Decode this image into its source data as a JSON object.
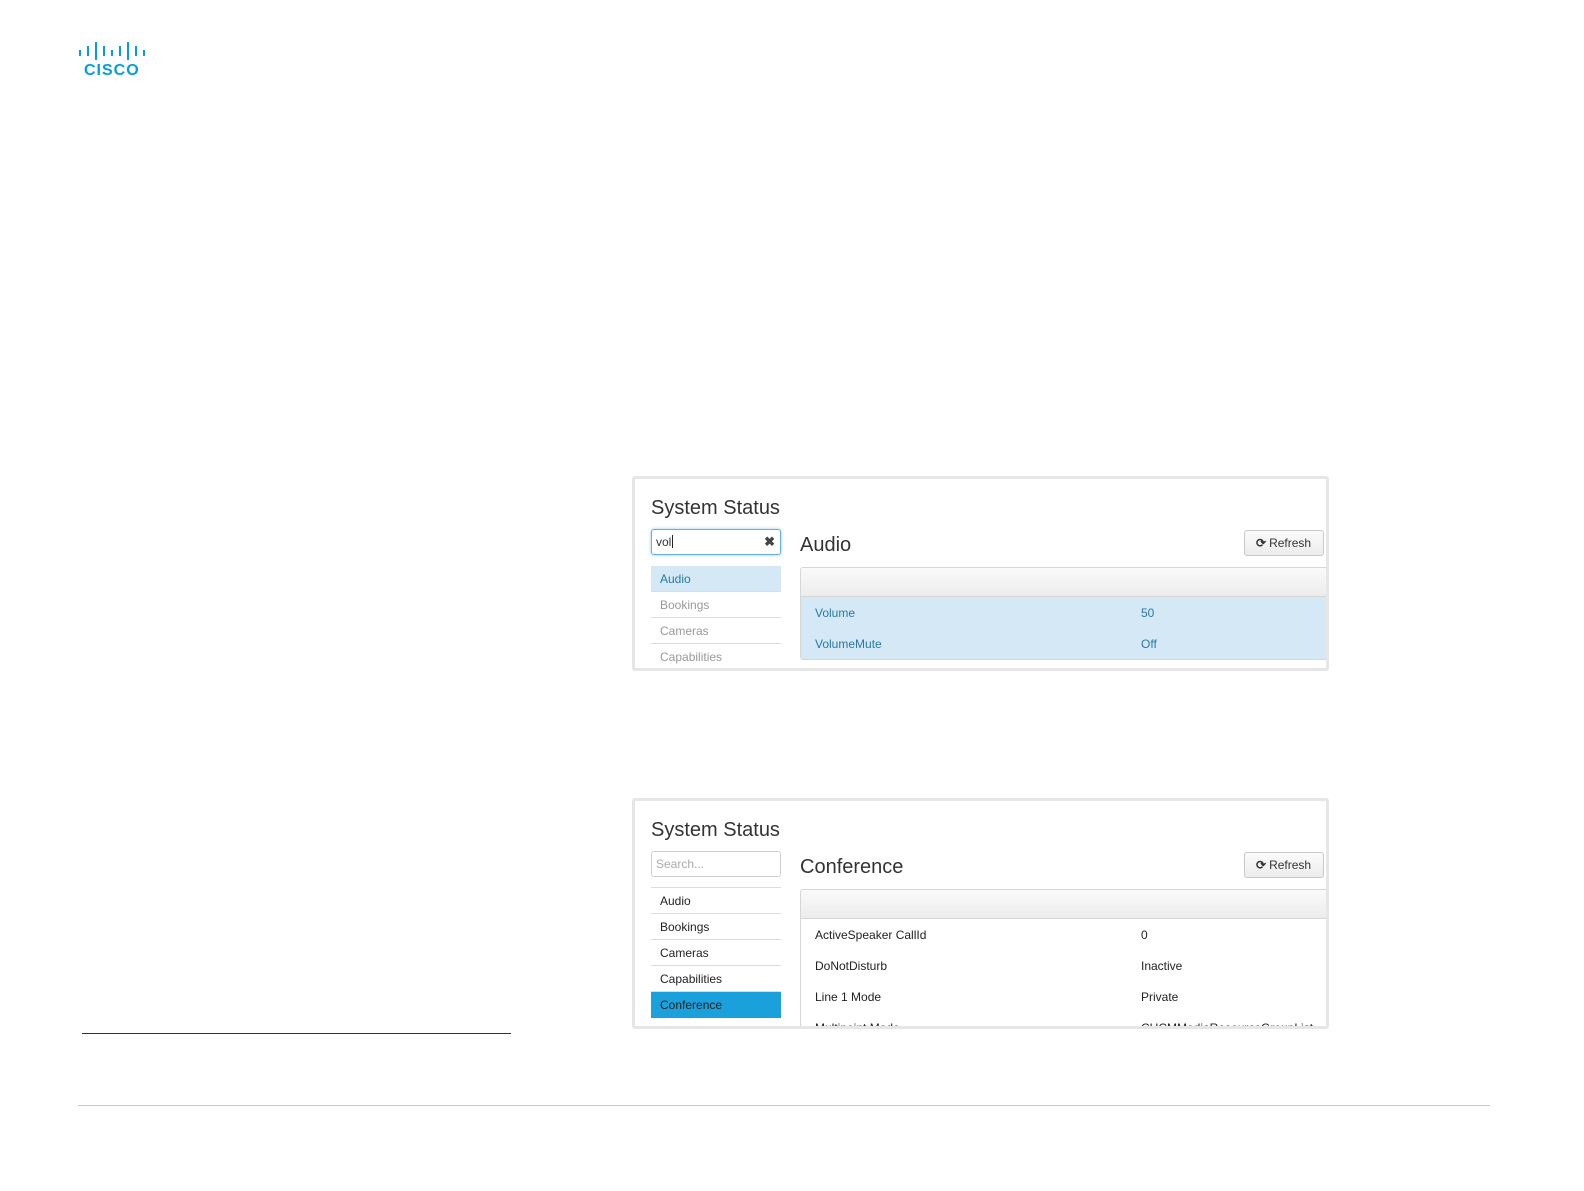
{
  "brand": {
    "logo_text": "CISCO",
    "accent_color": "#049fd9"
  },
  "screenshot1": {
    "title": "System Status",
    "search": {
      "value": "vol",
      "placeholder": "Search..."
    },
    "nav": [
      "Audio",
      "Bookings",
      "Cameras",
      "Capabilities"
    ],
    "selected_nav": "Audio",
    "section_title": "Audio",
    "refresh_label": "Refresh",
    "rows": [
      {
        "key": "Volume",
        "value": "50"
      },
      {
        "key": "VolumeMute",
        "value": "Off"
      }
    ]
  },
  "screenshot2": {
    "title": "System Status",
    "search": {
      "value": "",
      "placeholder": "Search..."
    },
    "nav": [
      "Audio",
      "Bookings",
      "Cameras",
      "Capabilities",
      "Conference"
    ],
    "selected_nav": "Conference",
    "section_title": "Conference",
    "refresh_label": "Refresh",
    "rows": [
      {
        "key": "ActiveSpeaker CallId",
        "value": "0"
      },
      {
        "key": "DoNotDisturb",
        "value": "Inactive"
      },
      {
        "key": "Line 1 Mode",
        "value": "Private"
      },
      {
        "key": "Multipoint Mode",
        "value": "CUCMMediaResourceGroupList"
      }
    ]
  }
}
